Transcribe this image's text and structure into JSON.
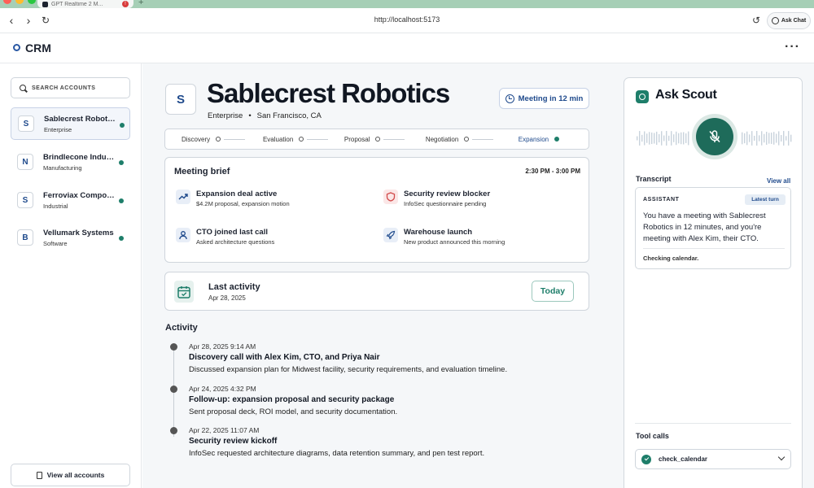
{
  "browser": {
    "tab_title": "GPT Realtime 2 M...",
    "tab_close_badge": "!",
    "new_tab": "+",
    "url": "http://localhost:5173",
    "ask_chat_label": "Ask Chat"
  },
  "app": {
    "title": "CRM",
    "menu_glyph": "···"
  },
  "sidebar": {
    "search_placeholder": "SEARCH ACCOUNTS",
    "accounts": [
      {
        "initial": "S",
        "name": "Sablecrest Robotics",
        "industry": "Enterprise",
        "selected": true
      },
      {
        "initial": "N",
        "name": "Brindlecone Industries",
        "industry": "Manufacturing",
        "selected": false
      },
      {
        "initial": "S",
        "name": "Ferroviax Components",
        "industry": "Industrial",
        "selected": false
      },
      {
        "initial": "B",
        "name": "Vellumark Systems",
        "industry": "Software",
        "selected": false
      }
    ],
    "view_all_label": "View all accounts"
  },
  "company": {
    "initial": "S",
    "name": "Sablecrest Robotics",
    "segment": "Enterprise",
    "separator": "•",
    "location": "San Francisco, CA",
    "meeting_label": "Meeting in 12 min"
  },
  "stages": [
    {
      "label": "Discovery",
      "active": false
    },
    {
      "label": "Evaluation",
      "active": false
    },
    {
      "label": "Proposal",
      "active": false
    },
    {
      "label": "Negotiation",
      "active": false
    },
    {
      "label": "Expansion",
      "active": true
    }
  ],
  "brief": {
    "title": "Meeting brief",
    "time": "2:30 PM - 3:00 PM",
    "items": [
      {
        "icon": "trending-up-icon",
        "title": "Expansion deal active",
        "subtitle": "$4.2M proposal, expansion motion"
      },
      {
        "icon": "shield-icon",
        "title": "Security review blocker",
        "subtitle": "InfoSec questionnaire pending"
      },
      {
        "icon": "user-icon",
        "title": "CTO joined last call",
        "subtitle": "Asked architecture questions"
      },
      {
        "icon": "rocket-icon",
        "title": "Warehouse launch",
        "subtitle": "New product announced this morning"
      }
    ]
  },
  "last_activity": {
    "title": "Last activity",
    "date": "Apr 28, 2025",
    "button": "Today"
  },
  "activity": {
    "heading": "Activity",
    "events": [
      {
        "date": "Apr 28, 2025 9:14 AM",
        "title": "Discovery call with Alex Kim, CTO, and Priya Nair",
        "desc": "Discussed expansion plan for Midwest facility, security requirements, and evaluation timeline."
      },
      {
        "date": "Apr 24, 2025 4:32 PM",
        "title": "Follow-up: expansion proposal and security package",
        "desc": "Sent proposal deck, ROI model, and security documentation."
      },
      {
        "date": "Apr 22, 2025 11:07 AM",
        "title": "Security review kickoff",
        "desc": "InfoSec requested architecture diagrams, data retention summary, and pen test report."
      }
    ]
  },
  "scout": {
    "title": "Ask Scout",
    "transcript_heading": "Transcript",
    "view_all": "View all",
    "role": "ASSISTANT",
    "badge": "Latest turn",
    "message": "You have a meeting with Sablecrest Robotics in 12 minutes, and you're meeting with Alex Kim, their CTO.",
    "status": "Checking calendar.",
    "tool_calls_heading": "Tool calls",
    "tool_call": "check_calendar"
  },
  "colors": {
    "accent_teal": "#1e7e6a",
    "accent_blue": "#1f4a8c",
    "danger": "#d24a4a"
  }
}
